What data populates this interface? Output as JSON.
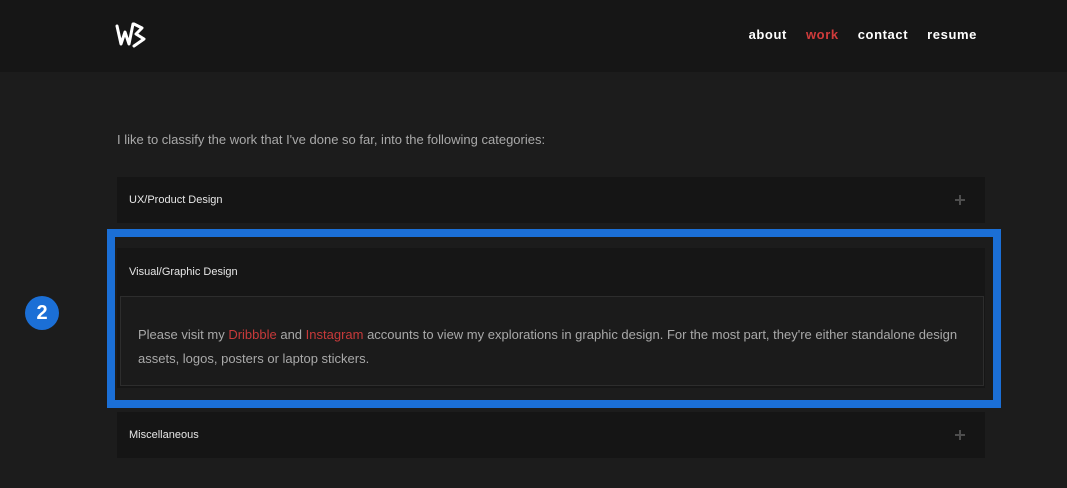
{
  "header": {
    "logo_icon": "wb-monogram-logo",
    "nav": [
      {
        "label": "about",
        "active": false
      },
      {
        "label": "work",
        "active": true
      },
      {
        "label": "contact",
        "active": false
      },
      {
        "label": "resume",
        "active": false
      }
    ]
  },
  "main": {
    "intro": "I like to classify the work that I've done so far, into the following categories:",
    "accordion": [
      {
        "title": "UX/Product Design",
        "expanded": false,
        "icon": "plus-icon"
      },
      {
        "title": "Visual/Graphic Design",
        "expanded": true,
        "body": {
          "text_before": "Please visit my ",
          "link1": "Dribbble",
          "text_mid": " and ",
          "link2": "Instagram",
          "text_after": " accounts to view my explorations in graphic design. For the most part, they're either standalone design assets, logos, posters or laptop stickers."
        }
      },
      {
        "title": "Miscellaneous",
        "expanded": false,
        "icon": "plus-icon"
      }
    ]
  },
  "annotation": {
    "step_number": "2",
    "highlight_color": "#1b6fd6"
  },
  "colors": {
    "accent_red": "#d03b3b",
    "background": "#1c1c1c",
    "header_bg": "#161616"
  }
}
